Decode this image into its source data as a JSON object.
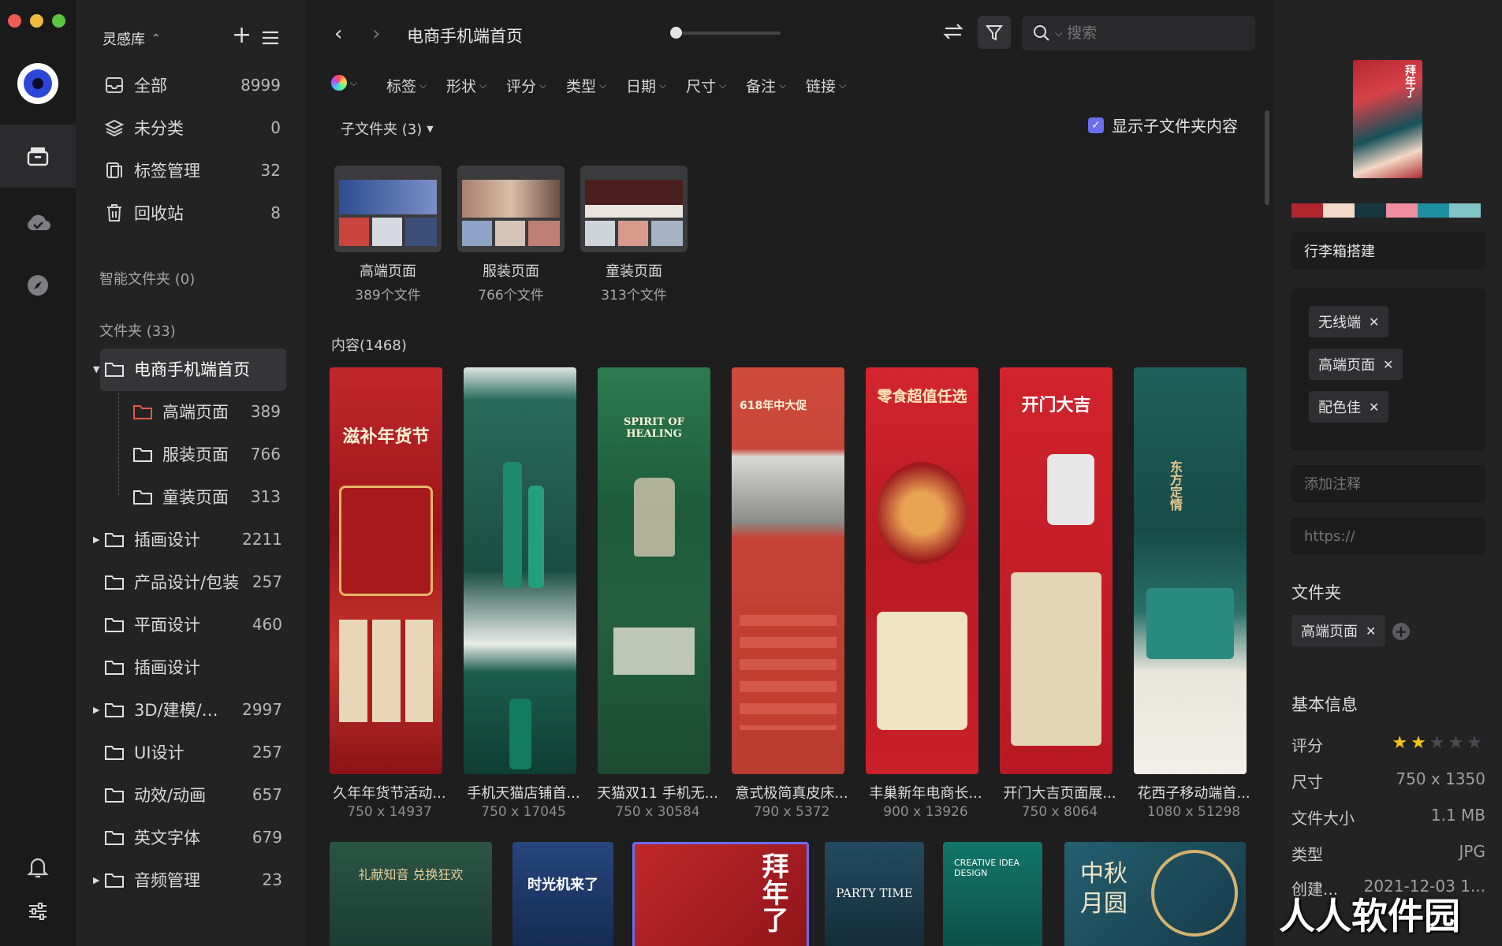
{
  "library": {
    "name": "灵感库"
  },
  "sidebar": {
    "top_items": [
      {
        "label": "全部",
        "count": "8999"
      },
      {
        "label": "未分类",
        "count": "0"
      },
      {
        "label": "标签管理",
        "count": "32"
      },
      {
        "label": "回收站",
        "count": "8"
      }
    ],
    "smart_folders_label": "智能文件夹 (0)",
    "folders_label": "文件夹 (33)",
    "folders": [
      {
        "label": "电商手机端首页",
        "count": ""
      },
      {
        "label": "高端页面",
        "count": "389"
      },
      {
        "label": "服装页面",
        "count": "766"
      },
      {
        "label": "童装页面",
        "count": "313"
      },
      {
        "label": "插画设计",
        "count": "2211"
      },
      {
        "label": "产品设计/包装",
        "count": "257"
      },
      {
        "label": "平面设计",
        "count": "460"
      },
      {
        "label": "插画设计",
        "count": ""
      },
      {
        "label": "3D/建模/…",
        "count": "2997"
      },
      {
        "label": "UI设计",
        "count": "257"
      },
      {
        "label": "动效/动画",
        "count": "657"
      },
      {
        "label": "英文字体",
        "count": "679"
      },
      {
        "label": "音频管理",
        "count": "23"
      }
    ]
  },
  "toolbar": {
    "title": "电商手机端首页",
    "search_placeholder": "搜索"
  },
  "filters": [
    "标签",
    "形状",
    "评分",
    "类型",
    "日期",
    "尺寸",
    "备注",
    "链接"
  ],
  "subfolder_label": "子文件夹 (3)",
  "show_sub_label": "显示子文件夹内容",
  "subfolders": [
    {
      "name": "高端页面",
      "count": "389个文件"
    },
    {
      "name": "服装页面",
      "count": "766个文件"
    },
    {
      "name": "童装页面",
      "count": "313个文件"
    }
  ],
  "content_label": "内容(1468)",
  "cards": [
    {
      "name": "久年年货节活动...",
      "dim": "750 x 14937",
      "thumb_title": "滋补年货节",
      "bg": "#b51d22"
    },
    {
      "name": "手机天猫店铺首...",
      "dim": "750 x 17045",
      "thumb_title": "",
      "bg": "#1d5a4c"
    },
    {
      "name": "天猫双11 手机无...",
      "dim": "750 x 30584",
      "thumb_title": "SPIRIT OF HEALING",
      "bg": "#1f5b3a"
    },
    {
      "name": "意式极简真皮床...",
      "dim": "790 x 5372",
      "thumb_title": "618年中大促",
      "bg": "#c8473a"
    },
    {
      "name": "丰巢新年电商长...",
      "dim": "900 x 13926",
      "thumb_title": "零食超值任选",
      "bg": "#c11f2a"
    },
    {
      "name": "开门大吉页面展...",
      "dim": "750 x 8064",
      "thumb_title": "开门大吉",
      "bg": "#c5222c"
    },
    {
      "name": "花西子移动端首...",
      "dim": "1080 x 51298",
      "thumb_title": "东方定情",
      "bg": "#1d5b57"
    }
  ],
  "bottom_cards": [
    {
      "title": "礼献知音 兑换狂欢",
      "bg": "#234a3f"
    },
    {
      "title": "时光机来了",
      "bg": "#1e3b6a"
    },
    {
      "title": "拜年了",
      "bg": "#b52228"
    },
    {
      "title": "PARTY TIME",
      "bg": "#1a3a4e"
    },
    {
      "title": "CREATIVE IDEA DESIGN",
      "bg": "#13665a"
    },
    {
      "title": "中秋 月圆",
      "bg": "#1d4a5a"
    }
  ],
  "panel": {
    "palette": [
      "#b3262f",
      "#f4d8c8",
      "#17363f",
      "#f08ea0",
      "#1f8fa0",
      "#82c4c8"
    ],
    "name_value": "行李箱搭建",
    "tags": [
      "无线端",
      "高端页面",
      "配色佳"
    ],
    "note_placeholder": "添加注释",
    "url_placeholder": "https://",
    "folder_heading": "文件夹",
    "folder_tag": "高端页面",
    "info_heading": "基本信息",
    "rating_label": "评分",
    "rating": 2,
    "rating_max": 5,
    "size_label": "尺寸",
    "size_value": "750 x 1350",
    "filesize_label": "文件大小",
    "filesize_value": "1.1 MB",
    "type_label": "类型",
    "type_value": "JPG",
    "created_label": "创建...",
    "created_value": "2021-12-03 1..."
  },
  "watermark": "人人软件园"
}
